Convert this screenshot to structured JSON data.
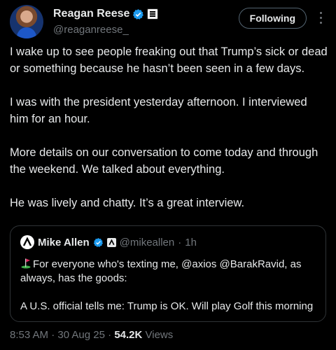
{
  "author": {
    "display_name": "Reagan Reese",
    "handle": "@reaganreese_"
  },
  "follow_button": {
    "label": "Following"
  },
  "tweet": {
    "paragraphs": [
      "I wake up to see people freaking out that Trump’s sick or dead or something because he hasn’t been seen in a few days.",
      "I was with the president yesterday afternoon. I interviewed him for an hour.",
      "More details on our conversation to come today and through the weekend. We talked about everything.",
      "He was lively and chatty. It’s a great interview."
    ]
  },
  "quoted_tweet": {
    "display_name": "Mike Allen",
    "handle": "@mikeallen",
    "separator": "·",
    "time": "1h",
    "line1": "For everyone who's texting me, @axios @BarakRavid, as always, has the goods:",
    "line2": "A U.S. official tells me: Trump is OK. Will play Golf this morning"
  },
  "meta": {
    "time": "8:53 AM",
    "sep1": "·",
    "date": "30 Aug 25",
    "sep2": "·",
    "views_count": "54.2K",
    "views_label": "Views"
  },
  "colors": {
    "background": "#000000",
    "text": "#e7e9ea",
    "muted": "#71767b",
    "verified": "#1d9bf0",
    "border": "#2f3336"
  },
  "icons": [
    "verified-badge-icon",
    "affiliate-badge-icon",
    "more-icon",
    "axios-logo-icon",
    "golf-flag-icon"
  ]
}
